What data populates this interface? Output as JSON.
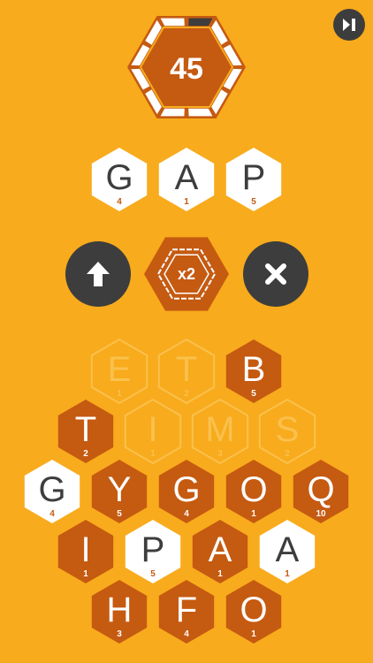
{
  "timer": {
    "value": "45",
    "progress_fraction": 0.92
  },
  "multiplier": {
    "label": "x2"
  },
  "controls": {
    "skip_icon": "skip-forward-icon",
    "submit_icon": "arrow-up-icon",
    "clear_icon": "close-icon"
  },
  "colors": {
    "background": "#F8AB1C",
    "tile_dark": "#C55A11",
    "tile_white": "#FFFFFF",
    "button_dark": "#3D3D3D",
    "letter_dark": "#3D3D3D",
    "letter_light": "#FFFFFF",
    "score_orange": "#C55A11",
    "ghost_outline": "#FAC14E"
  },
  "current_word": {
    "tiles": [
      {
        "letter": "G",
        "score": "4"
      },
      {
        "letter": "A",
        "score": "1"
      },
      {
        "letter": "P",
        "score": "5"
      }
    ]
  },
  "board": {
    "rows": [
      [
        {
          "letter": "E",
          "score": "1",
          "state": "ghost"
        },
        {
          "letter": "T",
          "score": "2",
          "state": "ghost"
        },
        {
          "letter": "B",
          "score": "5",
          "state": "dark"
        }
      ],
      [
        {
          "letter": "T",
          "score": "2",
          "state": "dark"
        },
        {
          "letter": "I",
          "score": "1",
          "state": "ghost"
        },
        {
          "letter": "M",
          "score": "3",
          "state": "ghost"
        },
        {
          "letter": "S",
          "score": "2",
          "state": "ghost"
        }
      ],
      [
        {
          "letter": "G",
          "score": "4",
          "state": "white"
        },
        {
          "letter": "Y",
          "score": "5",
          "state": "dark"
        },
        {
          "letter": "G",
          "score": "4",
          "state": "dark"
        },
        {
          "letter": "O",
          "score": "1",
          "state": "dark"
        },
        {
          "letter": "Q",
          "score": "10",
          "state": "dark"
        }
      ],
      [
        {
          "letter": "I",
          "score": "1",
          "state": "dark"
        },
        {
          "letter": "P",
          "score": "5",
          "state": "white"
        },
        {
          "letter": "A",
          "score": "1",
          "state": "dark"
        },
        {
          "letter": "A",
          "score": "1",
          "state": "white"
        }
      ],
      [
        {
          "letter": "H",
          "score": "3",
          "state": "dark"
        },
        {
          "letter": "F",
          "score": "4",
          "state": "dark"
        },
        {
          "letter": "O",
          "score": "1",
          "state": "dark"
        }
      ]
    ]
  }
}
